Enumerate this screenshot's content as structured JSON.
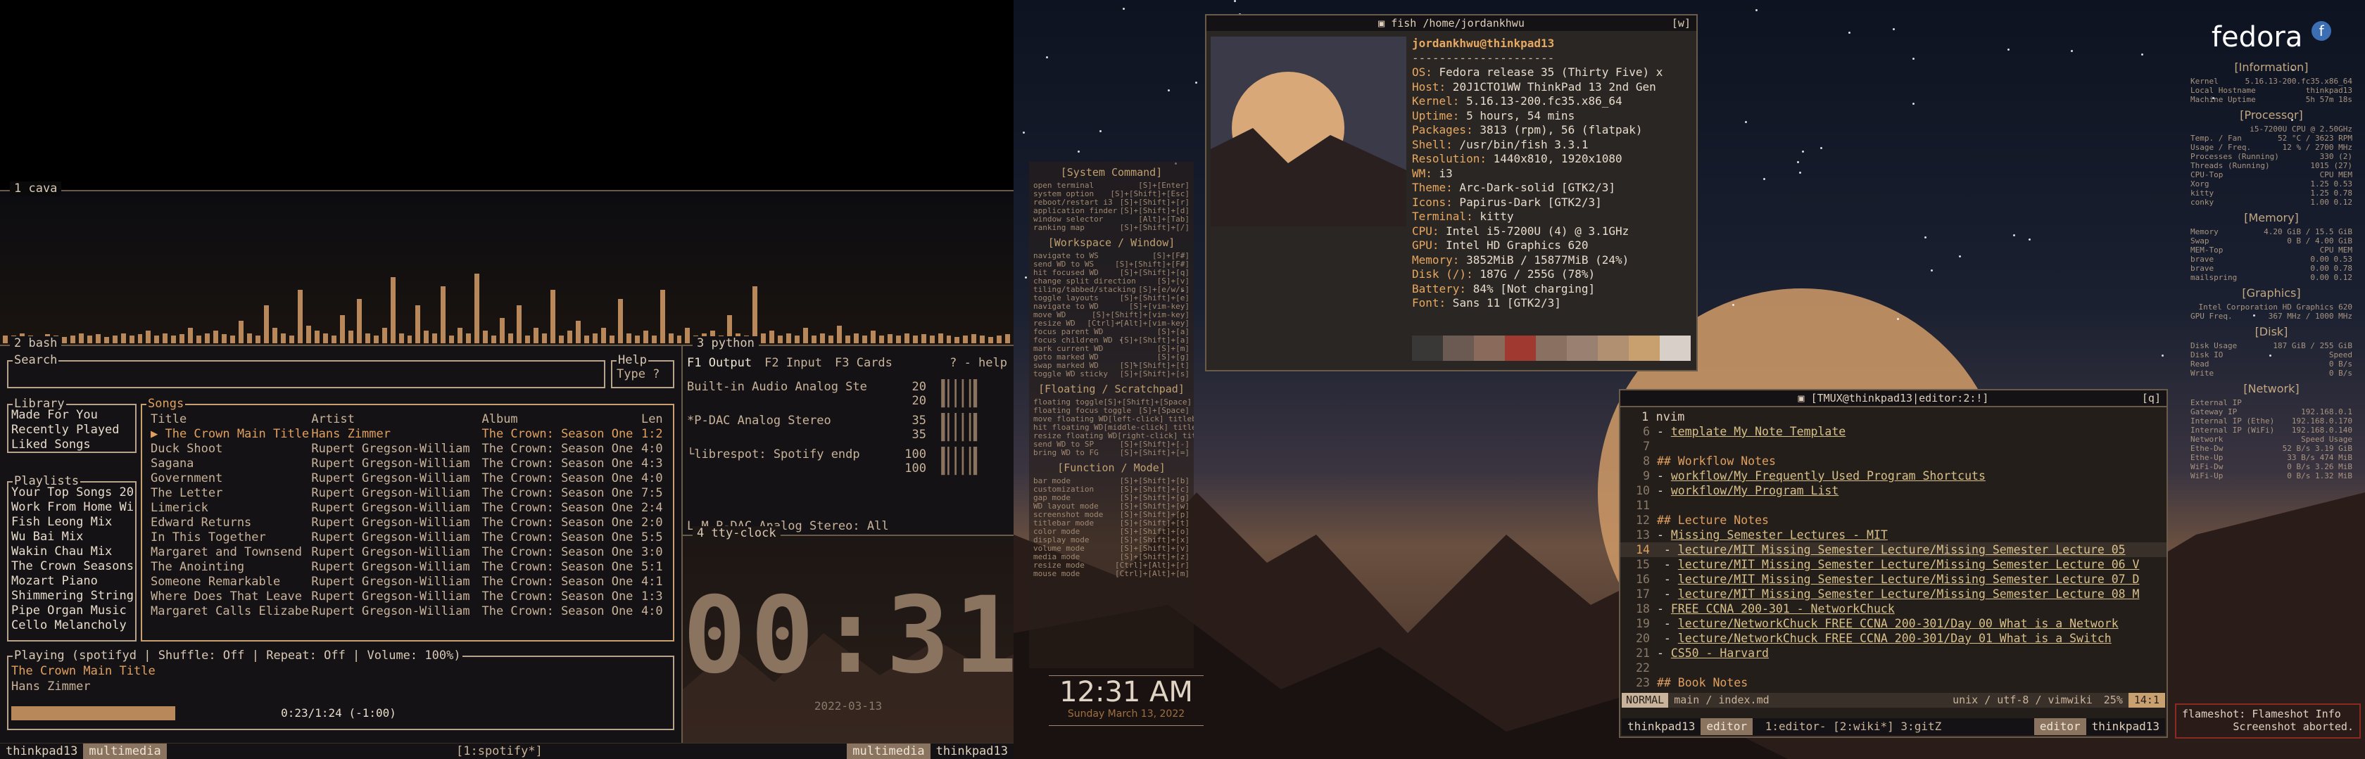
{
  "left": {
    "cava": {
      "title": "1 cava",
      "levels": [
        0.06,
        0.06,
        0.08,
        0.06,
        0.05,
        0.07,
        0.06,
        0.05,
        0.06,
        0.08,
        0.06,
        0.07,
        0.05,
        0.06,
        0.08,
        0.06,
        0.07,
        0.1,
        0.06,
        0.08,
        0.06,
        0.07,
        0.12,
        0.06,
        0.08,
        0.1,
        0.07,
        0.06,
        0.18,
        0.08,
        0.06,
        0.3,
        0.12,
        0.08,
        0.06,
        0.42,
        0.14,
        0.1,
        0.08,
        0.06,
        0.22,
        0.1,
        0.35,
        0.08,
        0.06,
        0.12,
        0.52,
        0.08,
        0.06,
        0.3,
        0.1,
        0.08,
        0.45,
        0.06,
        0.12,
        0.08,
        0.55,
        0.1,
        0.06,
        0.2,
        0.08,
        0.3,
        0.06,
        0.12,
        0.08,
        0.42,
        0.06,
        0.1,
        0.18,
        0.06,
        0.08,
        0.12,
        0.06,
        0.35,
        0.08,
        0.06,
        0.1,
        0.06,
        0.42,
        0.08,
        0.06,
        0.12,
        0.06,
        0.08,
        0.1,
        0.06,
        0.22,
        0.08,
        0.06,
        0.45,
        0.08,
        0.1,
        0.06,
        0.08,
        0.06,
        0.12,
        0.06,
        0.08,
        0.06,
        0.14,
        0.06,
        0.08,
        0.06,
        0.1,
        0.06,
        0.07,
        0.06,
        0.08,
        0.06,
        0.07,
        0.06,
        0.08,
        0.06,
        0.05,
        0.06,
        0.07,
        0.06,
        0.05,
        0.06,
        0.07
      ]
    },
    "bash": {
      "title": "2 bash",
      "search_label": "Search",
      "help_label": "Help",
      "help_text": "Type ?",
      "library_label": "Library",
      "library": [
        "Made For You",
        "Recently Played",
        "Liked Songs"
      ],
      "playlists_label": "Playlists",
      "playlists": [
        "Your Top Songs 20",
        "Work From Home Wi",
        "Fish Leong Mix",
        "Wu Bai Mix",
        "Wakin Chau Mix",
        "The Crown Seasons",
        "Mozart Piano",
        "Shimmering String",
        "Pipe Organ Music",
        "Cello Melancholy"
      ],
      "songs_label": "Songs",
      "columns": [
        "Title",
        "Artist",
        "Album",
        "Len"
      ],
      "songs": [
        [
          "▶ The Crown Main Title",
          "Hans Zimmer",
          "The Crown: Season One",
          "1:2"
        ],
        [
          "Duck Shoot",
          "Rupert Gregson-William",
          "The Crown: Season One",
          "4:0"
        ],
        [
          "Sagana",
          "Rupert Gregson-William",
          "The Crown: Season One",
          "4:3"
        ],
        [
          "Government",
          "Rupert Gregson-William",
          "The Crown: Season One",
          "4:0"
        ],
        [
          "The Letter",
          "Rupert Gregson-William",
          "The Crown: Season One",
          "7:5"
        ],
        [
          "Limerick",
          "Rupert Gregson-William",
          "The Crown: Season One",
          "2:4"
        ],
        [
          "Edward Returns",
          "Rupert Gregson-William",
          "The Crown: Season One",
          "2:0"
        ],
        [
          "In This Together",
          "Rupert Gregson-William",
          "The Crown: Season One",
          "5:5"
        ],
        [
          "Margaret and Townsend",
          "Rupert Gregson-William",
          "The Crown: Season One",
          "3:0"
        ],
        [
          "The Anointing",
          "Rupert Gregson-William",
          "The Crown: Season One",
          "5:1"
        ],
        [
          "Someone Remarkable",
          "Rupert Gregson-William",
          "The Crown: Season One",
          "4:1"
        ],
        [
          "Where Does That Leave",
          "Rupert Gregson-William",
          "The Crown: Season One",
          "1:3"
        ],
        [
          "Margaret Calls Elizabe",
          "Rupert Gregson-William",
          "The Crown: Season One",
          "4:0"
        ]
      ],
      "playing_label": "Playing (spotifyd | Shuffle: Off | Repeat: Off  | Volume: 100%)",
      "playing_title": "The Crown Main Title",
      "playing_artist": "Hans Zimmer",
      "progress": 0.25,
      "progress_text": "0:23/1:24 (-1:00)"
    },
    "python": {
      "title": "3 python",
      "tabs": [
        "F1 Output",
        "F2 Input",
        "F3 Cards"
      ],
      "help": "? - help",
      "lines": [
        [
          "Built-in Audio Analog Ste",
          "20"
        ],
        [
          "",
          "20"
        ],
        [
          "*P-DAC Analog Stereo",
          "35"
        ],
        [
          "",
          "35"
        ],
        [
          "└librespot: Spotify endp",
          "100"
        ],
        [
          "",
          "100"
        ]
      ],
      "footer": "L M  P-DAC Analog Stereo: All"
    },
    "clock": {
      "title": "4 tty-clock",
      "time": "00:31",
      "date": "2022-03-13"
    },
    "statusbar": {
      "host": "thinkpad13",
      "tag": "multimedia",
      "window": "[1:spotify*]",
      "tag_right": "multimedia",
      "host_right": "thinkpad13"
    }
  },
  "right": {
    "cheatsheet": {
      "sections": [
        {
          "title": "[System Command]",
          "items": [
            [
              "open terminal",
              "[S]+[Enter]"
            ],
            [
              "system option",
              "[S]+[Shift]+[Esc]"
            ],
            [
              "reboot/restart i3",
              "[S]+[Shift]+[r]"
            ],
            [
              "application finder",
              "[S]+[Shift]+[d]"
            ],
            [
              "window selector",
              "[Alt]+[Tab]"
            ],
            [
              "ranking map",
              "[S]+[Shift]+[/]"
            ]
          ]
        },
        {
          "title": "[Workspace / Window]",
          "items": [
            [
              "navigate to WS",
              "[S]+[F#]"
            ],
            [
              "send WD to WS",
              "[S]+[Shift]+[F#]"
            ],
            [
              "hit focused WD",
              "[S]+[Shift]+[q]"
            ],
            [
              "change split direction",
              "[S]+[v]"
            ],
            [
              "tiling/tabbed/stacking",
              "[S]+[e/w/s]"
            ],
            [
              "toggle layouts",
              "[S]+[Shift]+[e]"
            ],
            [
              "navigate to WD",
              "[S]+[vim-key]"
            ],
            [
              "move WD",
              "[S]+[Shift]+[vim-key]"
            ],
            [
              "resize WD",
              "[Ctrl]+[Alt]+[vim-key]"
            ],
            [
              "focus parent WD",
              "[S]+[a]"
            ],
            [
              "focus children WD",
              "[S]+[Shift]+[a]"
            ],
            [
              "mark current WD",
              "[S]+[m]"
            ],
            [
              "goto marked WD",
              "[S]+[g]"
            ],
            [
              "swap marked WD",
              "[S]+[Shift]+[t]"
            ],
            [
              "toggle WD sticky",
              "[S]+[Shift]+[s]"
            ]
          ]
        },
        {
          "title": "[Floating / Scratchpad]",
          "items": [
            [
              "floating toggle",
              "[S]+[Shift]+[Space]"
            ],
            [
              "floating focus toggle",
              "[S]+[Space]"
            ],
            [
              "move floating WD",
              "[left-click] titlebar"
            ],
            [
              "hit floating WD",
              "[middle-click] titlebar"
            ],
            [
              "resize floating WD",
              "[right-click] titlebar"
            ],
            [
              "send WD to SP",
              "[S]+[Shift]+[-]"
            ],
            [
              "bring WD to FG",
              "[S]+[Shift]+[=]"
            ]
          ]
        },
        {
          "title": "[Function / Mode]",
          "items": [
            [
              "bar mode",
              "[S]+[Shift]+[b]"
            ],
            [
              "customization",
              "[S]+[Shift]+[c]"
            ],
            [
              "gap mode",
              "[S]+[Shift]+[g]"
            ],
            [
              "WD layout mode",
              "[S]+[Shift]+[w]"
            ],
            [
              "screenshot mode",
              "[S]+[Shift]+[p]"
            ],
            [
              "titlebar mode",
              "[S]+[Shift]+[t]"
            ],
            [
              "color mode",
              "[S]+[Shift]+[o]"
            ],
            [
              "display mode",
              "[S]+[Shift]+[x]"
            ],
            [
              "volume mode",
              "[S]+[Shift]+[v]"
            ],
            [
              "media mode",
              "[S]+[Shift]+[z]"
            ],
            [
              "resize mode",
              "[Ctrl]+[Alt]+[r]"
            ],
            [
              "mouse mode",
              "[Ctrl]+[Alt]+[m]"
            ]
          ]
        }
      ]
    },
    "desktop_clock": {
      "time": "12:31 AM",
      "date": "Sunday March 13, 2022"
    },
    "neofetch": {
      "title": "fish /home/jordankhwu",
      "close": "[w]",
      "user": "jordankhwu@thinkpad13",
      "separator": "---------------------",
      "info": [
        [
          "OS:",
          "Fedora release 35 (Thirty Five) x"
        ],
        [
          "Host:",
          "20J1CTO1WW ThinkPad 13 2nd Gen"
        ],
        [
          "Kernel:",
          "5.16.13-200.fc35.x86_64"
        ],
        [
          "Uptime:",
          "5 hours, 54 mins"
        ],
        [
          "Packages:",
          "3813 (rpm), 56 (flatpak)"
        ],
        [
          "Shell:",
          "/usr/bin/fish 3.3.1"
        ],
        [
          "Resolution:",
          "1440x810, 1920x1080"
        ],
        [
          "WM:",
          "i3"
        ],
        [
          "Theme:",
          "Arc-Dark-solid [GTK2/3]"
        ],
        [
          "Icons:",
          "Papirus-Dark [GTK2/3]"
        ],
        [
          "Terminal:",
          "kitty"
        ],
        [
          "CPU:",
          "Intel i5-7200U (4) @ 3.1GHz"
        ],
        [
          "GPU:",
          "Intel HD Graphics 620"
        ],
        [
          "Memory:",
          "3852MiB / 15877MiB (24%)"
        ],
        [
          "Disk (/):",
          "187G / 255G (78%)"
        ],
        [
          "Battery:",
          "84% [Not charging]"
        ],
        [
          "Font:",
          "Sans 11 [GTK2/3]"
        ]
      ],
      "palette": [
        "#3a3836",
        "#6a5a52",
        "#8a6a5a",
        "#a03a30",
        "#8a7060",
        "#9a8070",
        "#b09070",
        "#c8a070",
        "#d8d0c8"
      ]
    },
    "nvim": {
      "title": "[TMUX@thinkpad13|editor:2:!]",
      "close": "[q]",
      "pane_title": "1 nvim",
      "lines": [
        [
          "6",
          "- ",
          "template My Note Template",
          ""
        ],
        [
          "7",
          "",
          "",
          ""
        ],
        [
          "8",
          "## Workflow Notes",
          "",
          ""
        ],
        [
          "9",
          "- ",
          "workflow/My Frequently Used Program Shortcuts",
          ""
        ],
        [
          "10",
          "- ",
          "workflow/My Program List",
          ""
        ],
        [
          "11",
          "",
          "",
          ""
        ],
        [
          "12",
          "## Lecture Notes",
          "",
          ""
        ],
        [
          "13",
          "- ",
          "Missing Semester Lectures - MIT",
          ""
        ],
        [
          "14",
          "    - ",
          "lecture/MIT Missing Semester Lecture/Missing Semester Lecture 05",
          ""
        ],
        [
          "15",
          "    - ",
          "lecture/MIT Missing Semester Lecture/Missing Semester Lecture 06 V",
          ""
        ],
        [
          "16",
          "    - ",
          "lecture/MIT Missing Semester Lecture/Missing Semester Lecture 07 D",
          ""
        ],
        [
          "17",
          "    - ",
          "lecture/MIT Missing Semester Lecture/Missing Semester Lecture 08 M",
          ""
        ],
        [
          "18",
          "- ",
          "FREE CCNA 200-301 - NetworkChuck",
          ""
        ],
        [
          "19",
          "    - ",
          "lecture/NetworkChuck FREE CCNA 200-301/Day 00 What is a Network",
          ""
        ],
        [
          "20",
          "    - ",
          "lecture/NetworkChuck FREE CCNA 200-301/Day 01 What is a Switch",
          ""
        ],
        [
          "21",
          "- ",
          "CS50 - Harvard",
          ""
        ],
        [
          "22",
          "",
          "",
          ""
        ],
        [
          "23",
          "## Book Notes",
          "",
          ""
        ]
      ],
      "mode": "NORMAL",
      "file": "main / index.md",
      "fileinfo": "unix / utf-8 / vimwiki",
      "percent": "25%",
      "pos": "14:1",
      "status_host": "thinkpad13",
      "status_tag": "editor",
      "status_window": "1:editor- [2:wiki*] 3:gitZ",
      "status_tag_right": "editor",
      "status_host_right": "thinkpad13"
    },
    "conky": {
      "logo": "fedora",
      "sections": [
        {
          "title": "[Information]",
          "items": [
            [
              "Kernel",
              "5.16.13-200.fc35.x86_64"
            ],
            [
              "Local Hostname",
              "thinkpad13"
            ],
            [
              "Machine Uptime",
              "5h 57m 18s"
            ]
          ]
        },
        {
          "title": "[Processor]",
          "items": [
            [
              "",
              "i5-7200U CPU @ 2.50GHz"
            ],
            [
              "Temp. / Fan",
              "52 °C / 3623 RPM"
            ],
            [
              "Usage / Freq.",
              "12 % / 2700 MHz"
            ],
            [
              "Processes (Running)",
              "330 (2)"
            ],
            [
              "Threads (Running)",
              "1015 (27)"
            ],
            [
              "CPU-Top",
              "CPU   MEM"
            ],
            [
              "Xorg",
              "1.25   0.53"
            ],
            [
              "kitty",
              "1.25   0.78"
            ],
            [
              "conky",
              "1.00   0.12"
            ]
          ]
        },
        {
          "title": "[Memory]",
          "items": [
            [
              "Memory",
              "4.20 GiB / 15.5 GiB"
            ],
            [
              "Swap",
              "0 B / 4.00 GiB"
            ],
            [
              "MEM-Top",
              "CPU   MEM"
            ],
            [
              "brave",
              "0.00   0.53"
            ],
            [
              "brave",
              "0.00   0.78"
            ],
            [
              "mailspring",
              "0.00   0.12"
            ]
          ]
        },
        {
          "title": "[Graphics]",
          "items": [
            [
              "",
              "Intel Corporation HD Graphics 620"
            ],
            [
              "GPU Freq.",
              "367 MHz / 1000 MHz"
            ]
          ]
        },
        {
          "title": "[Disk]",
          "items": [
            [
              "Disk Usage",
              "187 GiB / 255 GiB"
            ],
            [
              "Disk IO",
              "Speed"
            ],
            [
              "Read",
              "0 B/s"
            ],
            [
              "Write",
              "0 B/s"
            ]
          ]
        },
        {
          "title": "[Network]",
          "items": [
            [
              "External IP",
              ""
            ],
            [
              "Gateway IP",
              "192.168.0.1"
            ],
            [
              "Internal IP (Ethe)",
              "192.168.0.170"
            ],
            [
              "Internal IP (WiFi)",
              "192.168.0.140"
            ],
            [
              "Network",
              "Speed   Usage"
            ],
            [
              "Ethe-Dw",
              "52 B/s   3.19 GiB"
            ],
            [
              "Ethe-Up",
              "33 B/s   474 MiB"
            ],
            [
              "WiFi-Dw",
              "0 B/s   3.26 MiB"
            ],
            [
              "WiFi-Up",
              "0 B/s   1.32 MiB"
            ]
          ]
        }
      ]
    },
    "flameshot": {
      "title": "flameshot: Flameshot Info",
      "msg": "Screenshot aborted."
    }
  }
}
